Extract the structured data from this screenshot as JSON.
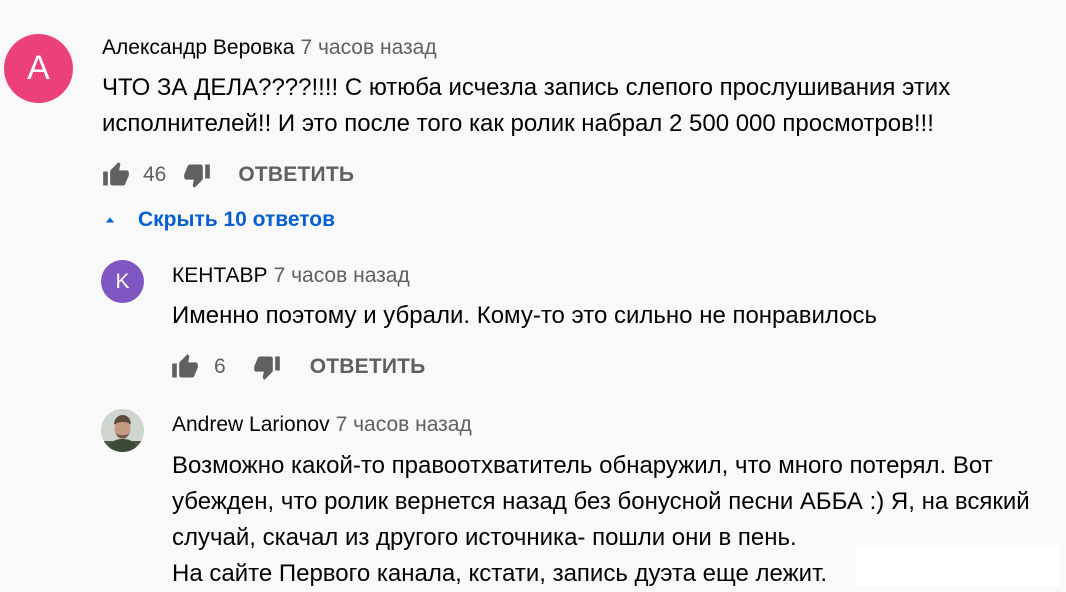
{
  "comments": {
    "main": {
      "avatar_letter": "A",
      "author": "Александр Веровка",
      "time": "7 часов назад",
      "text_lines": [
        "ЧТО ЗА ДЕЛА????!!!! С ютюба исчезла запись слепого прослушивания этих",
        "исполнителей!! И это после того как ролик набрал 2 500 000 просмотров!!!"
      ],
      "likes": "46",
      "reply_label": "ОТВЕТИТЬ",
      "toggle_label": "Скрыть 10 ответов"
    },
    "reply1": {
      "avatar_letter": "K",
      "author": "КЕНТАВР",
      "time": "7 часов назад",
      "text_lines": [
        "Именно поэтому и убрали. Кому-то это сильно не понравилось"
      ],
      "likes": "6",
      "reply_label": "ОТВЕТИТЬ"
    },
    "reply2": {
      "author": "Andrew Larionov",
      "time": "7 часов назад",
      "text_lines": [
        "Возможно какой-то правоотхватитель обнаружил, что много потерял. Вот",
        "убежден, что ролик вернется назад без бонусной песни АББА :) Я, на всякий",
        "случай, скачал из другого источника- пошли они в пень.",
        "На сайте Первого канала, кстати, запись дуэта еще лежит."
      ]
    }
  },
  "colors": {
    "background": "#f9f9f9",
    "avatar_main": "#ec407a",
    "avatar_reply1": "#7e57c2",
    "link": "#065fd4",
    "secondary_text": "#606060"
  },
  "icons": {
    "like": "thumbs-up-icon",
    "dislike": "thumbs-down-icon",
    "collapse": "caret-up-icon"
  }
}
